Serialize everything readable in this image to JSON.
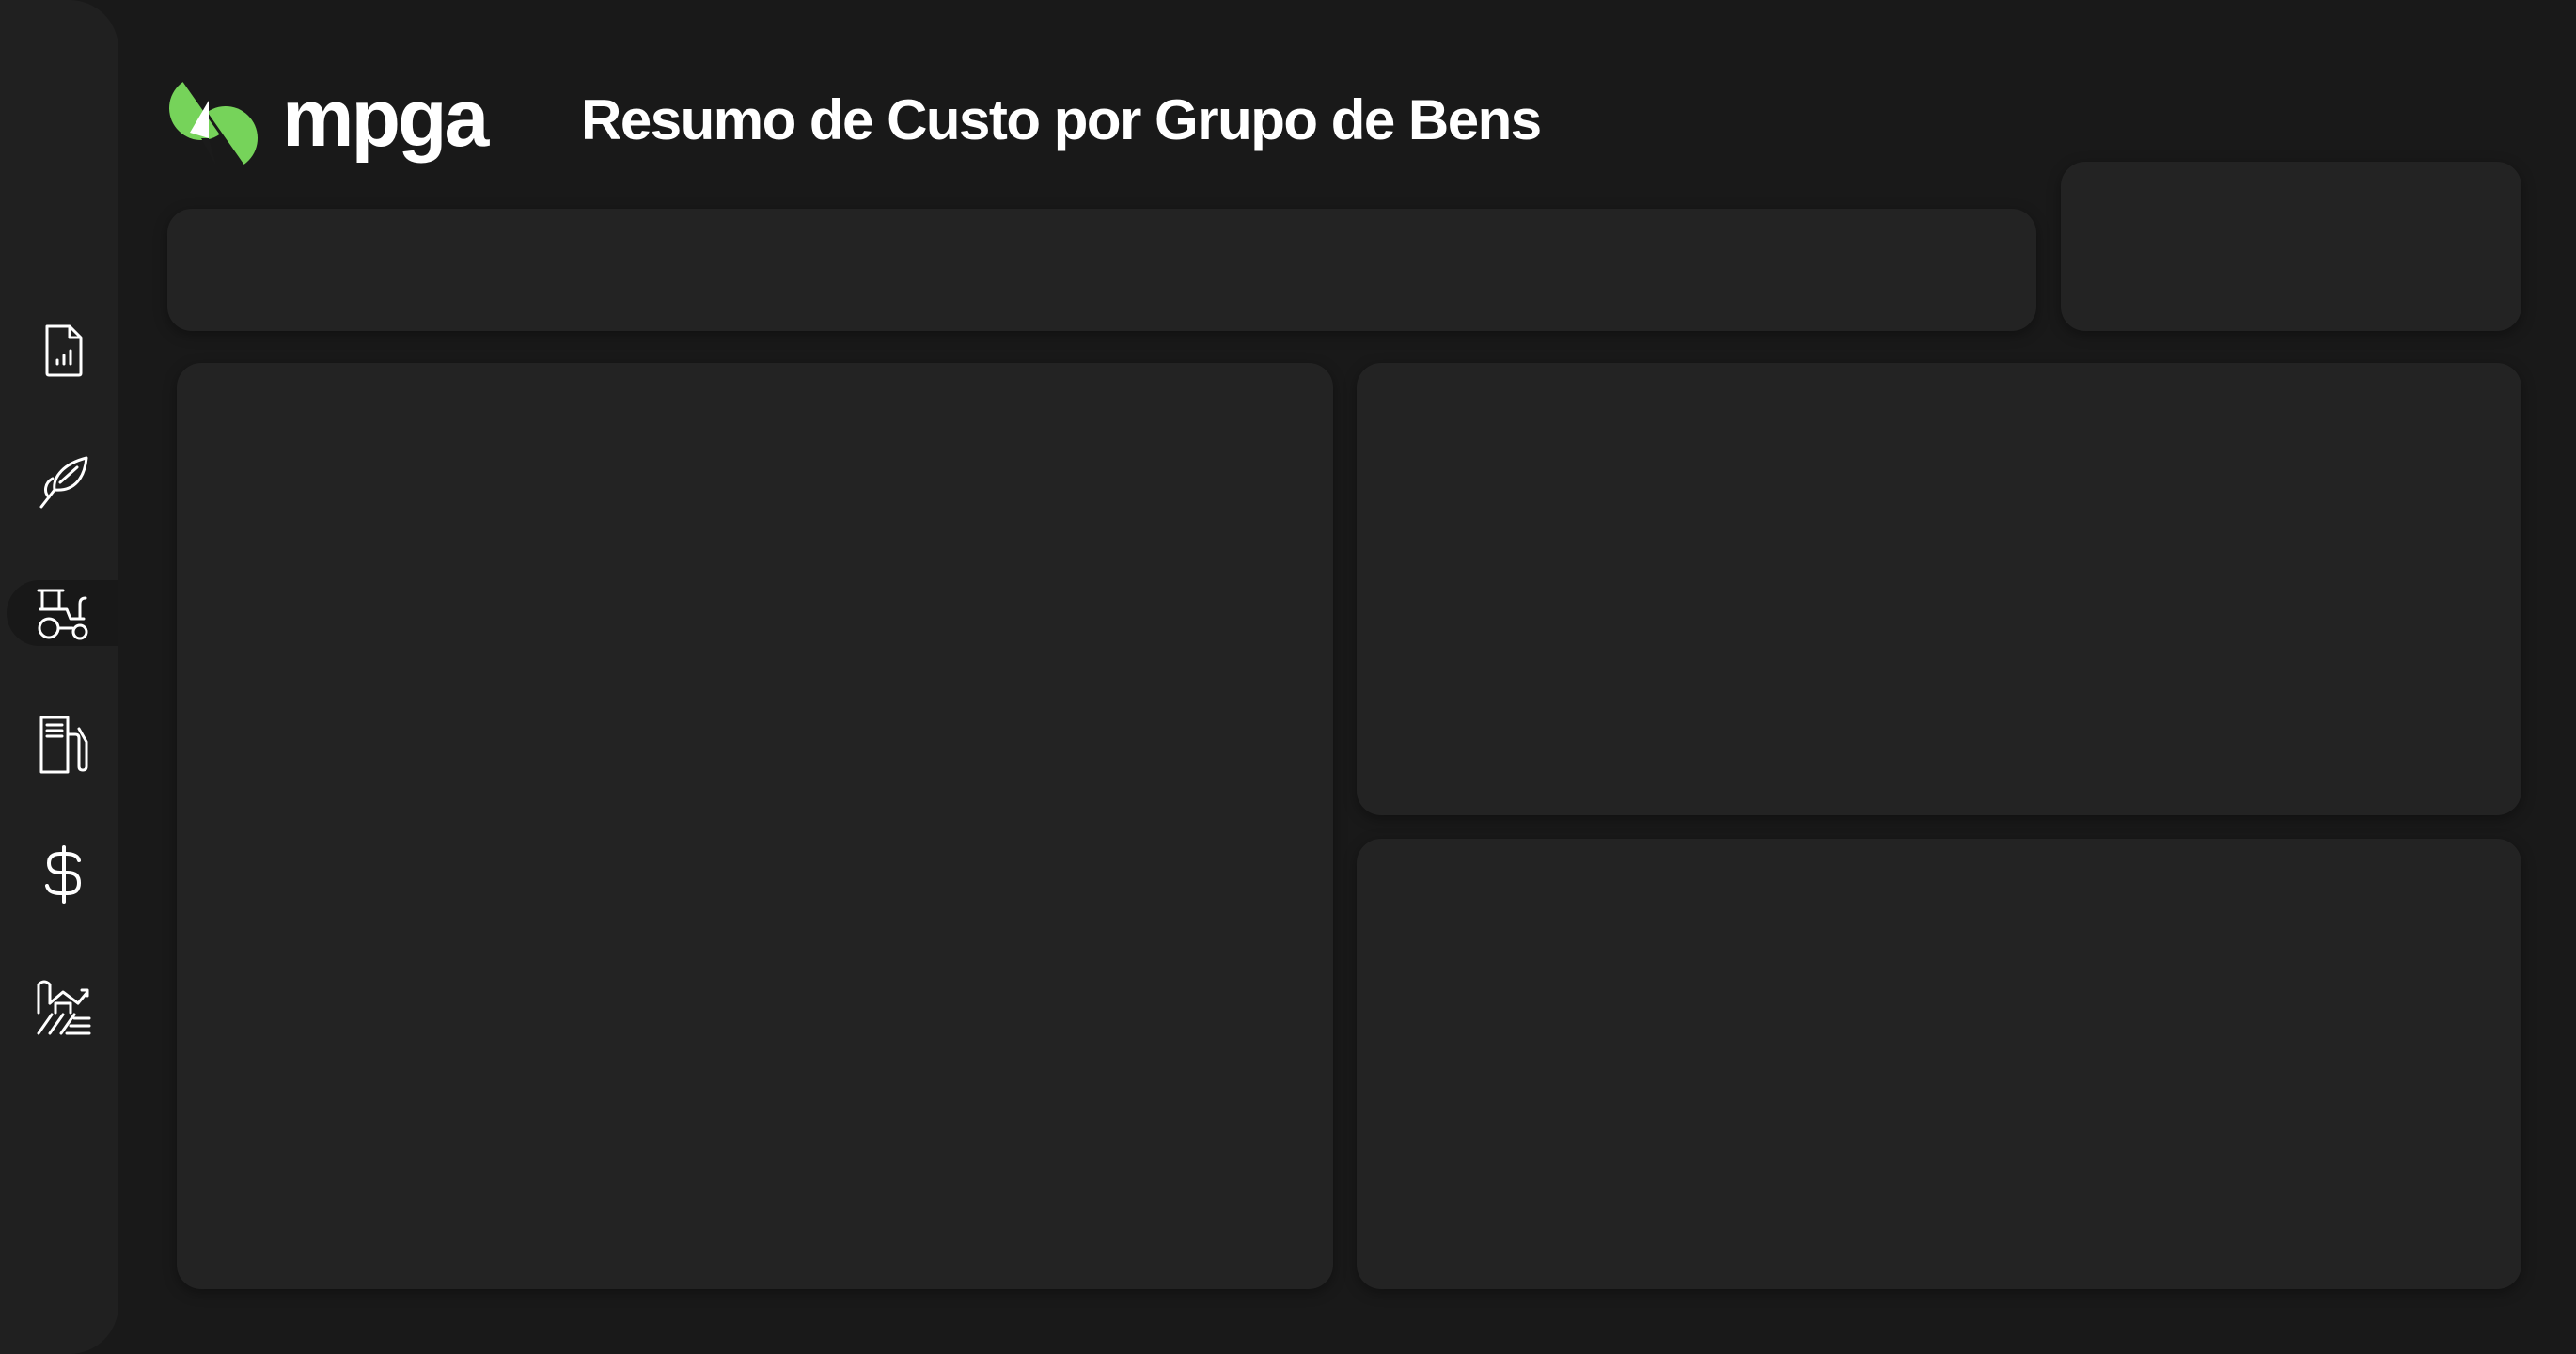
{
  "brand": {
    "name": "mpga",
    "accent_color": "#76d35a"
  },
  "header": {
    "title": "Resumo de Custo por Grupo de Bens"
  },
  "sidebar": {
    "items": [
      {
        "icon": "report-file-icon",
        "active": false
      },
      {
        "icon": "crop-leaf-icon",
        "active": false
      },
      {
        "icon": "tractor-icon",
        "active": true
      },
      {
        "icon": "fuel-pump-icon",
        "active": false
      },
      {
        "icon": "dollar-icon",
        "active": false
      },
      {
        "icon": "farm-icon",
        "active": false
      }
    ]
  }
}
